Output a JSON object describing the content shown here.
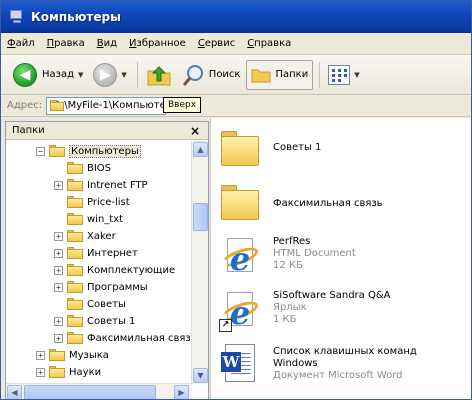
{
  "window": {
    "title": "Компьютеры"
  },
  "menu": [
    "Файл",
    "Правка",
    "Вид",
    "Избранное",
    "Сервис",
    "Справка"
  ],
  "toolbar": {
    "back_label": "Назад",
    "search_label": "Поиск",
    "folders_label": "Папки",
    "tooltip": "Вверх"
  },
  "address": {
    "label": "Адрес:",
    "value": "D:\\MyFile-1\\Компьютеры"
  },
  "folders_pane": {
    "title": "Папки",
    "close": "×",
    "tree": [
      {
        "label": "Компьютеры",
        "expander": "−",
        "selected": true
      },
      {
        "label": "BIOS",
        "expander": ""
      },
      {
        "label": "Intrenet FTP",
        "expander": "+"
      },
      {
        "label": "Price-list",
        "expander": ""
      },
      {
        "label": "win_txt",
        "expander": ""
      },
      {
        "label": "Xaker",
        "expander": "+"
      },
      {
        "label": "Интернет",
        "expander": "+"
      },
      {
        "label": "Комплектующие",
        "expander": "+"
      },
      {
        "label": "Программы",
        "expander": "+"
      },
      {
        "label": "Советы",
        "expander": ""
      },
      {
        "label": "Советы 1",
        "expander": "+"
      },
      {
        "label": "Факсимильная связь",
        "expander": "+"
      },
      {
        "label": "Музыка",
        "expander": "+"
      },
      {
        "label": "Науки",
        "expander": "+"
      }
    ]
  },
  "files": [
    {
      "name": "Советы 1",
      "type": "folder",
      "meta1": "",
      "meta2": ""
    },
    {
      "name": "Факсимильная связь",
      "type": "folder",
      "meta1": "",
      "meta2": ""
    },
    {
      "name": "PerfRes",
      "type": "html",
      "meta1": "HTML Document",
      "meta2": "12 КБ"
    },
    {
      "name": "SiSoftware Sandra Q&A",
      "type": "shortcut",
      "meta1": "Ярлык",
      "meta2": "1 КБ"
    },
    {
      "name": "Список клавишных команд",
      "name2": "Windows",
      "type": "word",
      "meta1": "Документ Microsoft Word",
      "meta2": ""
    }
  ]
}
